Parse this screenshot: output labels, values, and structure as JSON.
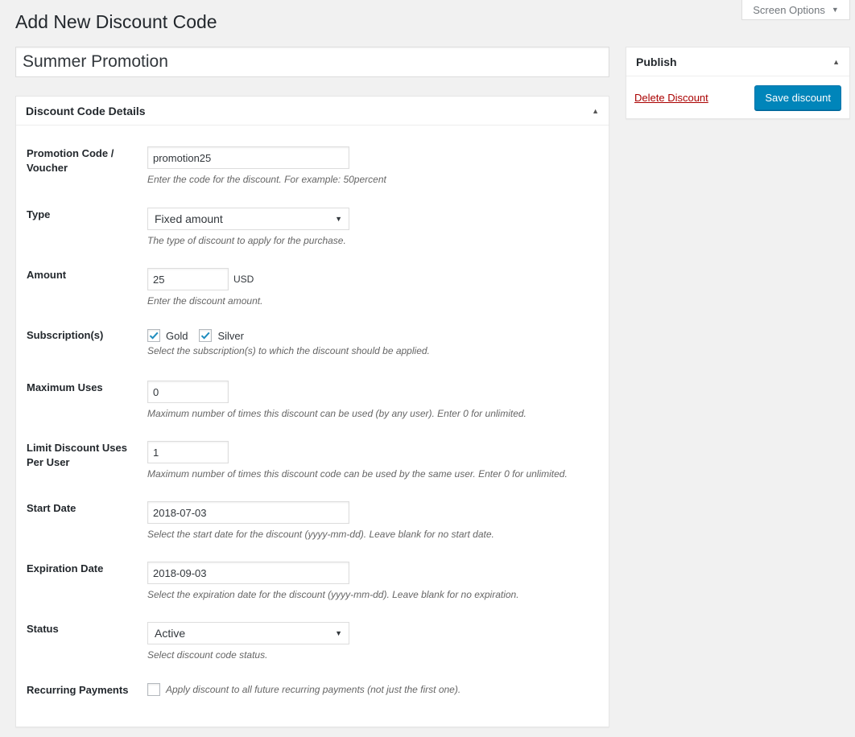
{
  "screen_options": {
    "label": "Screen Options"
  },
  "page": {
    "title": "Add New Discount Code"
  },
  "title_field": {
    "value": "Summer Promotion"
  },
  "publish": {
    "heading": "Publish",
    "delete_label": "Delete Discount",
    "save_label": "Save discount"
  },
  "details": {
    "heading": "Discount Code Details",
    "promotion_code": {
      "label": "Promotion Code / Voucher",
      "value": "promotion25",
      "description": "Enter the code for the discount. For example: 50percent"
    },
    "type": {
      "label": "Type",
      "selected": "Fixed amount",
      "description": "The type of discount to apply for the purchase."
    },
    "amount": {
      "label": "Amount",
      "value": "25",
      "unit": "USD",
      "description": "Enter the discount amount."
    },
    "subscriptions": {
      "label": "Subscription(s)",
      "options": [
        {
          "label": "Gold",
          "checked": true
        },
        {
          "label": "Silver",
          "checked": true
        }
      ],
      "description": "Select the subscription(s) to which the discount should be applied."
    },
    "maximum_uses": {
      "label": "Maximum Uses",
      "value": "0",
      "description": "Maximum number of times this discount can be used (by any user). Enter 0 for unlimited."
    },
    "limit_per_user": {
      "label": "Limit Discount Uses Per User",
      "value": "1",
      "description": "Maximum number of times this discount code can be used by the same user. Enter 0 for unlimited."
    },
    "start_date": {
      "label": "Start Date",
      "value": "2018-07-03",
      "description": "Select the start date for the discount (yyyy-mm-dd). Leave blank for no start date."
    },
    "expiration_date": {
      "label": "Expiration Date",
      "value": "2018-09-03",
      "description": "Select the expiration date for the discount (yyyy-mm-dd). Leave blank for no expiration."
    },
    "status": {
      "label": "Status",
      "selected": "Active",
      "description": "Select discount code status."
    },
    "recurring": {
      "label": "Recurring Payments",
      "checked": false,
      "description": "Apply discount to all future recurring payments (not just the first one)."
    }
  },
  "colors": {
    "background": "#f1f1f1",
    "primary_button": "#0085ba",
    "delete_link": "#a00000",
    "checkmark": "#1e8cbe"
  }
}
